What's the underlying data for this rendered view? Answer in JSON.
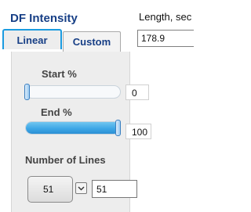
{
  "header": {
    "title": "DF Intensity"
  },
  "length": {
    "label": "Length, sec",
    "value": "178.9"
  },
  "tabs": [
    {
      "label": "Linear",
      "active": true
    },
    {
      "label": "Custom",
      "active": false
    }
  ],
  "start": {
    "label": "Start %",
    "value": "0",
    "level": 0
  },
  "end": {
    "label": "End %",
    "value": "100",
    "level": 100
  },
  "lines": {
    "label": "Number of Lines",
    "ring_value": "51",
    "input_value": "51"
  },
  "colors": {
    "accent": "#1a9be0",
    "title": "#173f86",
    "slider_fill": "#3ea7e6",
    "panel": "#ededed"
  }
}
